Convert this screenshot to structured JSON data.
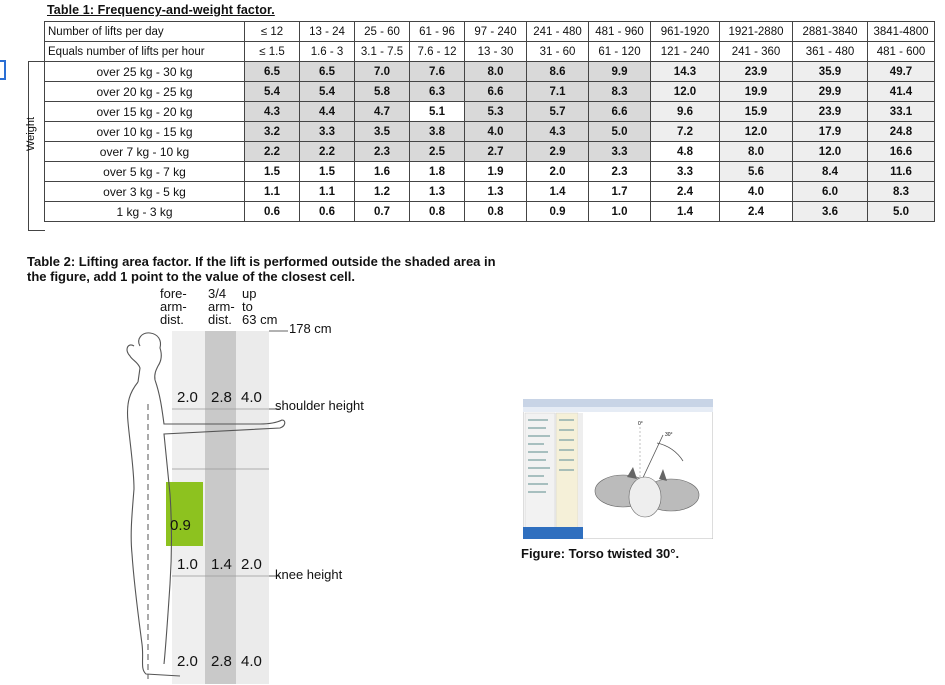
{
  "table1": {
    "title": "Table 1: Frequency-and-weight factor.",
    "header_label_1": "Number of lifts per day",
    "header_label_2": "Equals number of lifts per hour",
    "lifts_per_day": [
      "≤ 12",
      "13 - 24",
      "25 - 60",
      "61 - 96",
      "97 - 240",
      "241 - 480",
      "481 - 960",
      "961-1920",
      "1921-2880",
      "2881-3840",
      "3841-4800"
    ],
    "lifts_per_hour": [
      "≤ 1.5",
      "1.6 - 3",
      "3.1 - 7.5",
      "7.6 - 12",
      "13 - 30",
      "31 - 60",
      "61 - 120",
      "121 - 240",
      "241 - 360",
      "361 - 480",
      "481 - 600"
    ],
    "weight_axis_label": "Weight",
    "rows": [
      {
        "label": "over 25 kg - 30 kg",
        "values": [
          "6.5",
          "6.5",
          "7.0",
          "7.6",
          "8.0",
          "8.6",
          "9.9",
          "14.3",
          "23.9",
          "35.9",
          "49.7"
        ]
      },
      {
        "label": "over 20 kg - 25 kg",
        "values": [
          "5.4",
          "5.4",
          "5.8",
          "6.3",
          "6.6",
          "7.1",
          "8.3",
          "12.0",
          "19.9",
          "29.9",
          "41.4"
        ]
      },
      {
        "label": "over 15 kg - 20 kg",
        "values": [
          "4.3",
          "4.4",
          "4.7",
          "5.1",
          "5.3",
          "5.7",
          "6.6",
          "9.6",
          "15.9",
          "23.9",
          "33.1"
        ]
      },
      {
        "label": "over 10 kg - 15 kg",
        "values": [
          "3.2",
          "3.3",
          "3.5",
          "3.8",
          "4.0",
          "4.3",
          "5.0",
          "7.2",
          "12.0",
          "17.9",
          "24.8"
        ]
      },
      {
        "label": "over 7 kg - 10 kg",
        "values": [
          "2.2",
          "2.2",
          "2.3",
          "2.5",
          "2.7",
          "2.9",
          "3.3",
          "4.8",
          "8.0",
          "12.0",
          "16.6"
        ]
      },
      {
        "label": "over 5 kg - 7 kg",
        "values": [
          "1.5",
          "1.5",
          "1.6",
          "1.8",
          "1.9",
          "2.0",
          "2.3",
          "3.3",
          "5.6",
          "8.4",
          "11.6"
        ]
      },
      {
        "label": "over 3 kg - 5 kg",
        "values": [
          "1.1",
          "1.1",
          "1.2",
          "1.3",
          "1.3",
          "1.4",
          "1.7",
          "2.4",
          "4.0",
          "6.0",
          "8.3"
        ]
      },
      {
        "label": "1 kg - 3 kg",
        "values": [
          "0.6",
          "0.6",
          "0.7",
          "0.8",
          "0.8",
          "0.9",
          "1.0",
          "1.4",
          "2.4",
          "3.6",
          "5.0"
        ]
      }
    ],
    "shade": [
      [
        "d",
        "d",
        "d",
        "d",
        "d",
        "d",
        "d",
        "m",
        "m",
        "m",
        "m"
      ],
      [
        "d",
        "d",
        "d",
        "d",
        "d",
        "d",
        "d",
        "m",
        "m",
        "m",
        "m"
      ],
      [
        "d",
        "d",
        "d",
        "l",
        "d",
        "d",
        "d",
        "m",
        "m",
        "m",
        "m"
      ],
      [
        "d",
        "d",
        "d",
        "d",
        "d",
        "d",
        "d",
        "m",
        "m",
        "m",
        "m"
      ],
      [
        "d",
        "d",
        "d",
        "d",
        "d",
        "d",
        "d",
        "l",
        "m",
        "m",
        "m"
      ],
      [
        "l",
        "l",
        "l",
        "l",
        "l",
        "l",
        "l",
        "l",
        "m",
        "m",
        "m"
      ],
      [
        "l",
        "l",
        "l",
        "l",
        "l",
        "l",
        "l",
        "l",
        "l",
        "m",
        "m"
      ],
      [
        "l",
        "l",
        "l",
        "l",
        "l",
        "l",
        "l",
        "l",
        "l",
        "m",
        "m"
      ]
    ]
  },
  "table2": {
    "title": "Table 2: Lifting area factor. If the lift is performed outside the shaded area in the figure, add 1 point to the value of the closest cell.",
    "col_headers": [
      "fore-\narm-\ndist.",
      "3/4\narm-\ndist.",
      "up\nto\n63 cm"
    ],
    "height_178": "178 cm",
    "shoulder_height": "shoulder height",
    "knee_height": "knee height",
    "row_top": [
      "2.0",
      "2.8",
      "4.0"
    ],
    "highlight_value": "0.9",
    "row_mid": [
      "1.0",
      "1.4",
      "2.0"
    ],
    "row_bottom": [
      "2.0",
      "2.8",
      "4.0"
    ]
  },
  "figure": {
    "caption": "Figure: Torso twisted 30°.",
    "angle_zero": "0°",
    "angle_thirty": "30°"
  },
  "colors": {
    "highlight_green": "#8dc21f",
    "shade_dark": "#d9d9d9",
    "shade_mid": "#eeeeee"
  }
}
